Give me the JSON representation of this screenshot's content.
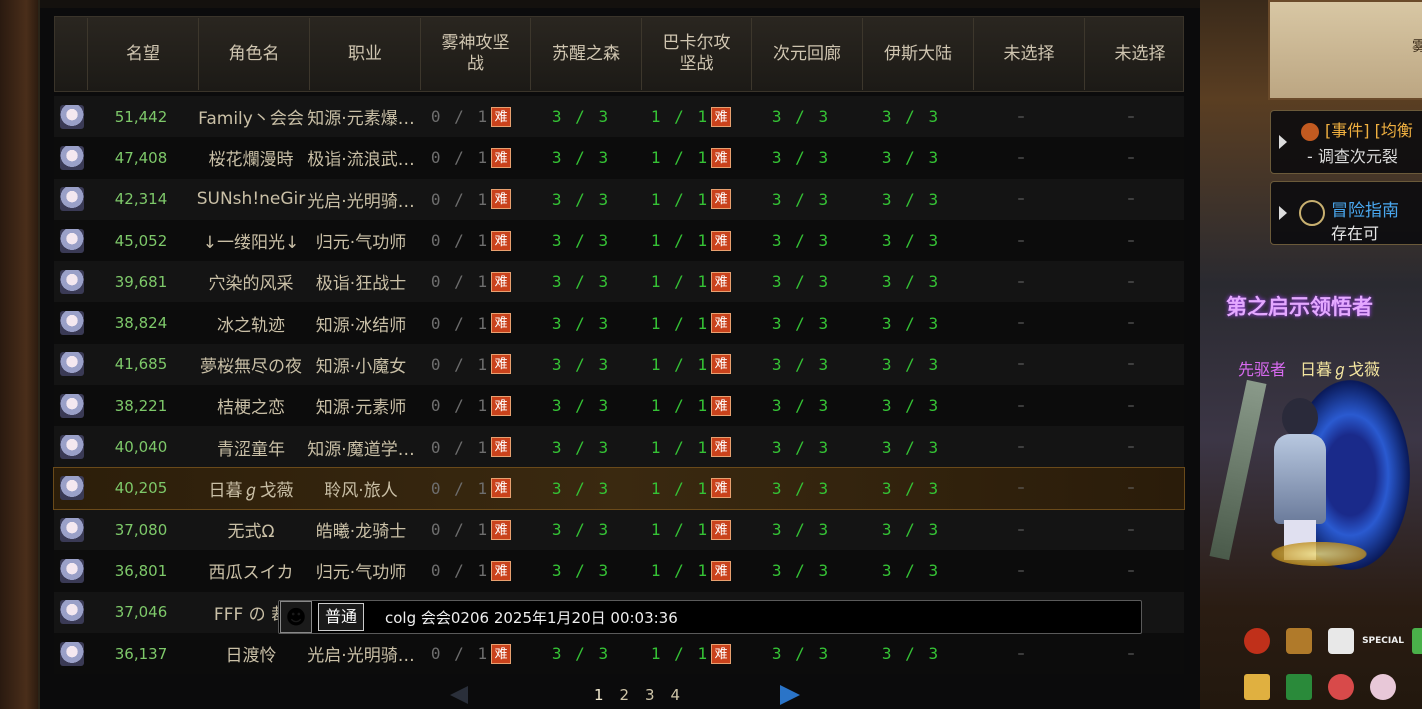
{
  "table": {
    "headers": [
      "名望",
      "角色名",
      "职业",
      "雾神攻坚战",
      "苏醒之森",
      "巴卡尔攻坚战",
      "次元回廊",
      "伊斯大陆",
      "未选择",
      "未选择"
    ],
    "hard_badge": "难",
    "rows": [
      {
        "fame": "51,442",
        "name": "Family丶会会",
        "job": "知源·元素爆…",
        "c1": "0 / 1",
        "c2": "3 / 3",
        "c3": "1 / 1",
        "c4": "3 / 3",
        "c5": "3 / 3",
        "c6": "–",
        "c7": "–"
      },
      {
        "fame": "47,408",
        "name": "桜花爛漫時",
        "job": "极诣·流浪武…",
        "c1": "0 / 1",
        "c2": "3 / 3",
        "c3": "1 / 1",
        "c4": "3 / 3",
        "c5": "3 / 3",
        "c6": "–",
        "c7": "–"
      },
      {
        "fame": "42,314",
        "name": "SUNsh!neGir",
        "job": "光启·光明骑…",
        "c1": "0 / 1",
        "c2": "3 / 3",
        "c3": "1 / 1",
        "c4": "3 / 3",
        "c5": "3 / 3",
        "c6": "–",
        "c7": "–"
      },
      {
        "fame": "45,052",
        "name": "↓一缕阳光↓",
        "job": "归元·气功师",
        "c1": "0 / 1",
        "c2": "3 / 3",
        "c3": "1 / 1",
        "c4": "3 / 3",
        "c5": "3 / 3",
        "c6": "–",
        "c7": "–"
      },
      {
        "fame": "39,681",
        "name": "穴染的风采",
        "job": "极诣·狂战士",
        "c1": "0 / 1",
        "c2": "3 / 3",
        "c3": "1 / 1",
        "c4": "3 / 3",
        "c5": "3 / 3",
        "c6": "–",
        "c7": "–"
      },
      {
        "fame": "38,824",
        "name": "冰之轨迹",
        "job": "知源·冰结师",
        "c1": "0 / 1",
        "c2": "3 / 3",
        "c3": "1 / 1",
        "c4": "3 / 3",
        "c5": "3 / 3",
        "c6": "–",
        "c7": "–"
      },
      {
        "fame": "41,685",
        "name": "夢桜無尽の夜",
        "job": "知源·小魔女",
        "c1": "0 / 1",
        "c2": "3 / 3",
        "c3": "1 / 1",
        "c4": "3 / 3",
        "c5": "3 / 3",
        "c6": "–",
        "c7": "–"
      },
      {
        "fame": "38,221",
        "name": "桔梗之恋",
        "job": "知源·元素师",
        "c1": "0 / 1",
        "c2": "3 / 3",
        "c3": "1 / 1",
        "c4": "3 / 3",
        "c5": "3 / 3",
        "c6": "–",
        "c7": "–"
      },
      {
        "fame": "40,040",
        "name": "青涩童年",
        "job": "知源·魔道学…",
        "c1": "0 / 1",
        "c2": "3 / 3",
        "c3": "1 / 1",
        "c4": "3 / 3",
        "c5": "3 / 3",
        "c6": "–",
        "c7": "–"
      },
      {
        "fame": "40,205",
        "name": "日暮ℊ戈薇",
        "job": "聆风·旅人",
        "c1": "0 / 1",
        "c2": "3 / 3",
        "c3": "1 / 1",
        "c4": "3 / 3",
        "c5": "3 / 3",
        "c6": "–",
        "c7": "–",
        "selected": true
      },
      {
        "fame": "37,080",
        "name": "无式Ω",
        "job": "皓曦·龙骑士",
        "c1": "0 / 1",
        "c2": "3 / 3",
        "c3": "1 / 1",
        "c4": "3 / 3",
        "c5": "3 / 3",
        "c6": "–",
        "c7": "–"
      },
      {
        "fame": "36,801",
        "name": "西瓜スイカ",
        "job": "归元·气功师",
        "c1": "0 / 1",
        "c2": "3 / 3",
        "c3": "1 / 1",
        "c4": "3 / 3",
        "c5": "3 / 3",
        "c6": "–",
        "c7": "–"
      },
      {
        "fame": "37,046",
        "name": "FFF の 裁",
        "job": "",
        "c1": "",
        "c2": "",
        "c3": "",
        "c4": "",
        "c5": "",
        "c6": "",
        "c7": "",
        "covered": true
      },
      {
        "fame": "36,137",
        "name": "日渡怜",
        "job": "光启·光明骑…",
        "c1": "0 / 1",
        "c2": "3 / 3",
        "c3": "1 / 1",
        "c4": "3 / 3",
        "c5": "3 / 3",
        "c6": "–",
        "c7": "–"
      }
    ]
  },
  "chat": {
    "channel": "普通",
    "message": "colg 会会0206 2025年1月20日 00:03:36"
  },
  "pager": {
    "pages": [
      "1",
      "2",
      "3",
      "4"
    ],
    "current": "1"
  },
  "scene": {
    "paper_text": "雾",
    "quest1_line1": "[事件] [均衡",
    "quest1_line2": "- 调查次元裂",
    "quest2_line1": "冒险指南",
    "quest2_line2": "存在可",
    "banner": "第之启示领悟者",
    "player_title": "先驱者",
    "player_name": "日暮ℊ戈薇",
    "special_label": "SPECIAL"
  },
  "colors": {
    "progress_green": "#35c235",
    "fame_green": "#7ec96a",
    "hard_orange": "#c9421c",
    "pager_blue": "#2a74c8"
  }
}
